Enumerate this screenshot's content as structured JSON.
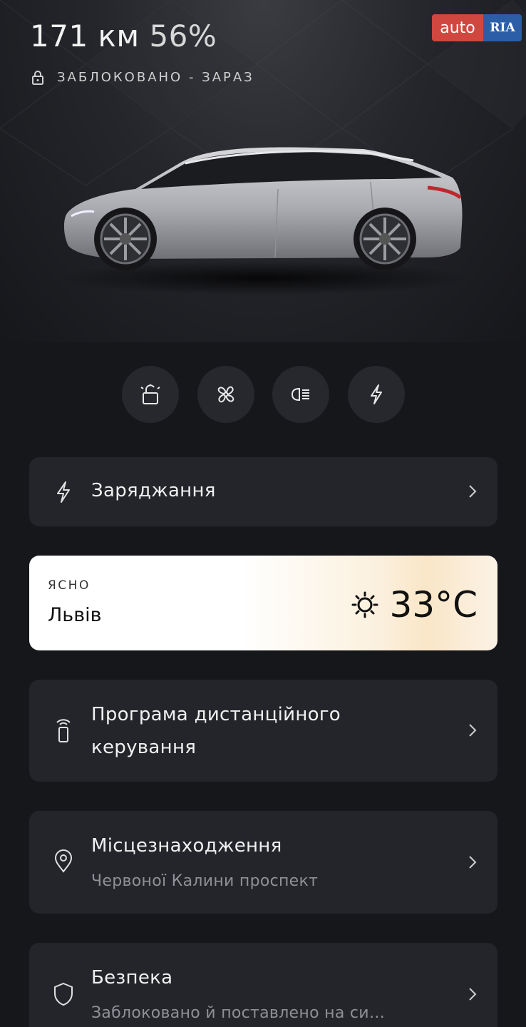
{
  "status": {
    "range": "171 км",
    "battery": "56%",
    "lock_text": "ЗАБЛОКОВАНО - ЗАРАЗ"
  },
  "watermark": {
    "part1": "auto",
    "part2": "RIA"
  },
  "quick_actions": [
    {
      "name": "lock-toggle",
      "icon": "unlock-icon"
    },
    {
      "name": "climate",
      "icon": "fan-icon"
    },
    {
      "name": "lights",
      "icon": "headlight-icon"
    },
    {
      "name": "charge",
      "icon": "bolt-icon"
    }
  ],
  "charging": {
    "title": "Заряджання",
    "icon": "bolt-icon"
  },
  "weather": {
    "condition": "ЯСНО",
    "city": "Львів",
    "temperature": "33°C",
    "icon": "sun-icon"
  },
  "remote": {
    "title_line1": "Програма дистанційного",
    "title_line2": "керування",
    "icon": "remote-key-icon"
  },
  "location": {
    "title": "Місцезнаходження",
    "address": "Червоної Калини проспект",
    "icon": "location-pin-icon"
  },
  "security": {
    "title": "Безпека",
    "status": "Заблоковано й поставлено на си…",
    "icon": "shield-icon"
  },
  "colors": {
    "background": "#16171b",
    "card": "#24252b",
    "button": "#26282e",
    "muted_text": "#8f9096"
  }
}
